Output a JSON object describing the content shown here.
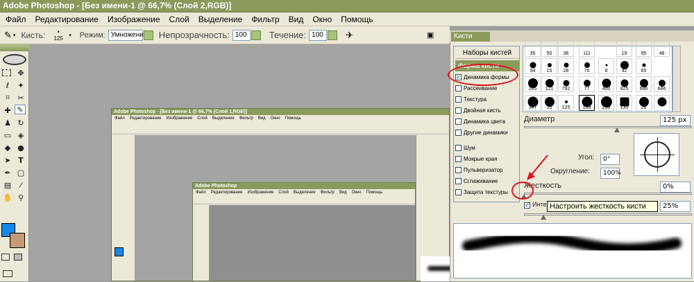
{
  "title": "Adobe Photoshop - [Без имени-1 @ 66,7% (Слой 2,RGB)]",
  "menu": [
    "Файл",
    "Редактирование",
    "Изображение",
    "Слой",
    "Выделение",
    "Фильтр",
    "Вид",
    "Окно",
    "Помощь"
  ],
  "options": {
    "brush_label": "Кисть:",
    "brush_size": "125",
    "mode_label": "Режим:",
    "mode_value": "Умножение",
    "opacity_label": "Непрозрачность:",
    "opacity_value": "100",
    "flow_label": "Течение:",
    "flow_value": "100"
  },
  "nested1": {
    "title": "Adobe Photoshop - [Без имени-1 @ 66,7% (Слой 1,RGB)]",
    "menu": [
      "Файл",
      "Редактирование",
      "Изображение",
      "Слой",
      "Выделение",
      "Фильтр",
      "Вид",
      "Окно",
      "Помощь"
    ]
  },
  "nested2": {
    "title": "Adobe Photoshop",
    "menu": [
      "Файл",
      "Редактирование",
      "Изображение",
      "Слой",
      "Выделение",
      "Фильтр",
      "Вид",
      "Окно",
      "Помощь"
    ]
  },
  "panel": {
    "tab": "Кисти",
    "list": [
      {
        "label": "Наборы кистей",
        "type": "header",
        "checked": false
      },
      {
        "label": "Форма кисти",
        "type": "selected",
        "checked": false
      },
      {
        "label": "Динамика формы",
        "type": "item",
        "checked": true
      },
      {
        "label": "Рассеивание",
        "type": "item",
        "checked": false
      },
      {
        "label": "Текстура",
        "type": "item",
        "checked": false
      },
      {
        "label": "Двойная кисть",
        "type": "item",
        "checked": false
      },
      {
        "label": "Динамика цвета",
        "type": "item",
        "checked": false
      },
      {
        "label": "Другие динамики",
        "type": "item",
        "checked": false
      },
      {
        "label": "Шум",
        "type": "item",
        "checked": false
      },
      {
        "label": "Мокрые края",
        "type": "item",
        "checked": false
      },
      {
        "label": "Пульверизатор",
        "type": "item",
        "checked": false
      },
      {
        "label": "Сглаживание",
        "type": "item",
        "checked": false
      },
      {
        "label": "Защита текстуры",
        "type": "item",
        "checked": false
      }
    ],
    "brushes": [
      "35",
      "50",
      "36",
      "111",
      "19",
      "95",
      "48",
      "54",
      "15",
      "28",
      "76",
      "8",
      "42",
      "65",
      "285",
      "121",
      "792",
      "77",
      "400",
      "825",
      "686",
      "686",
      "347",
      "10",
      "125",
      "169",
      "299",
      "130",
      "26"
    ],
    "diameter_label": "Диаметр",
    "diameter_value": "125 px",
    "angle_label": "Угол:",
    "angle_value": "0°",
    "roundness_label": "Округление:",
    "roundness_value": "100%",
    "hardness_label": "Жесткость",
    "hardness_value": "0%",
    "interval_label": "Интервал",
    "interval_value": "25%",
    "tooltip": "Настроить жесткость кисти"
  }
}
